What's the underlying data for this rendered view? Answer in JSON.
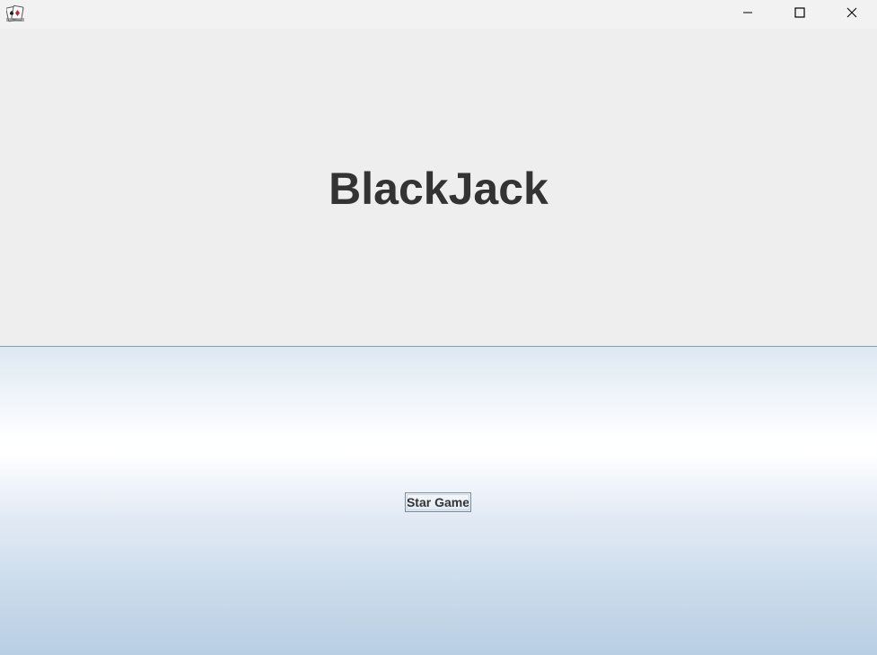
{
  "window": {
    "app_icon": "playing-cards-icon",
    "controls": {
      "minimize": "minimize-icon",
      "maximize": "maximize-icon",
      "close": "close-icon"
    }
  },
  "main": {
    "title": "BlackJack",
    "start_button_label": "Star Game"
  },
  "colors": {
    "title_text": "#333333",
    "title_panel_bg": "#eeeeee",
    "separator": "#7f9db9",
    "gradient_top": "#dde8f3",
    "gradient_mid": "#ffffff",
    "gradient_bottom": "#b8cfe4"
  }
}
